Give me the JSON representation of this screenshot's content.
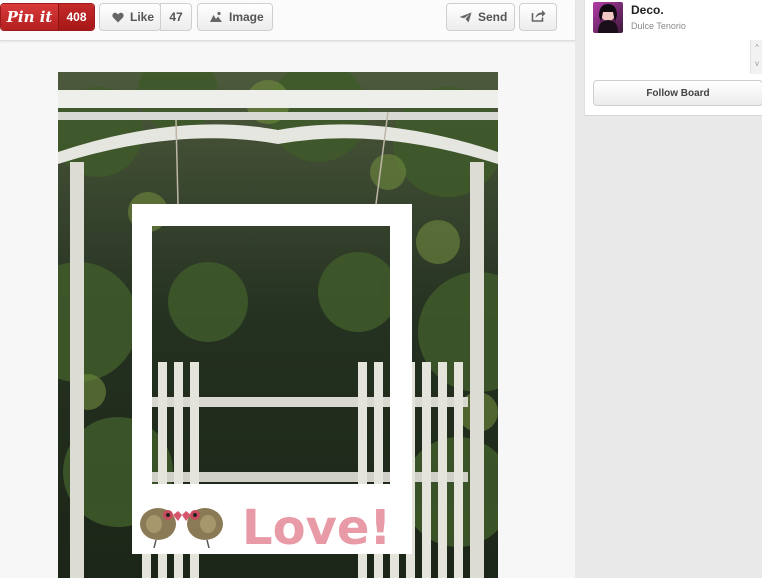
{
  "toolbar": {
    "pin_label": "Pin it",
    "pin_count": "408",
    "like_label": "Like",
    "like_count": "47",
    "image_label": "Image",
    "send_label": "Send"
  },
  "icons": {
    "like": "heart-icon",
    "image": "image-icon",
    "send": "paper-plane-icon",
    "share": "share-icon"
  },
  "sidebar": {
    "board_title": "Deco.",
    "board_owner": "Dulce Tenorio",
    "follow_label": "Follow Board"
  },
  "photo": {
    "overlay_text": "Love!"
  },
  "colors": {
    "pin_red": "#c92228",
    "love_pink": "#e89aa6"
  }
}
